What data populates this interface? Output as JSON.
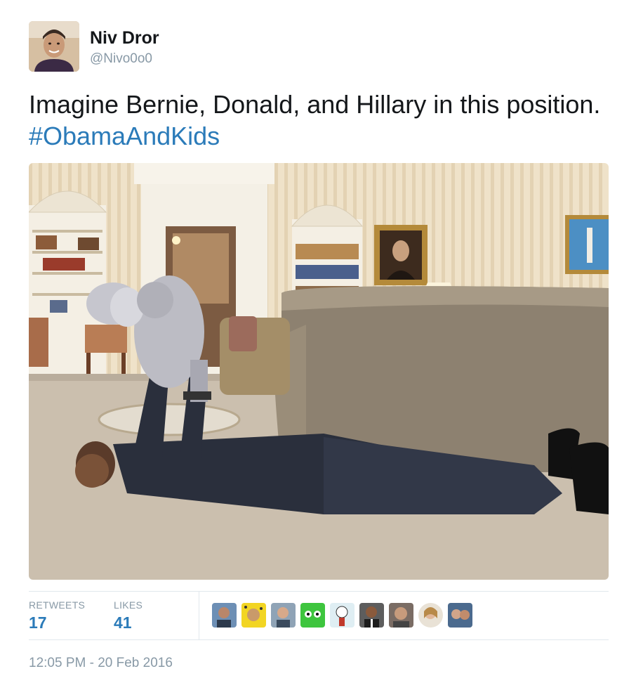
{
  "author": {
    "name": "Niv Dror",
    "handle": "@Nivo0o0"
  },
  "tweet": {
    "text": "Imagine Bernie, Donald, and Hillary in this position.",
    "hashtag": "#ObamaAndKids"
  },
  "stats": {
    "retweets_label": "RETWEETS",
    "retweets_count": "17",
    "likes_label": "LIKES",
    "likes_count": "41"
  },
  "likers_count": 9,
  "timestamp": "12:05 PM - 20 Feb 2016",
  "colors": {
    "link": "#2b7bb9",
    "muted": "#8899a6",
    "text": "#14171a",
    "divider": "#e1e8ed"
  }
}
